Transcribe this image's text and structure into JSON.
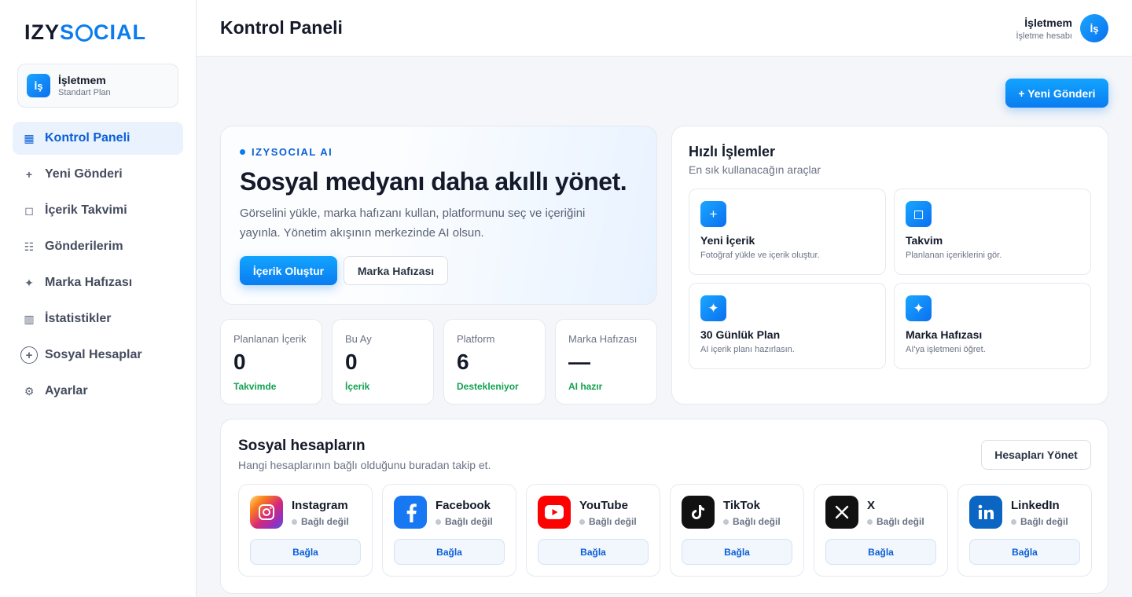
{
  "brand": {
    "logo_part1": "IZY",
    "logo_part2": "S",
    "logo_part3": "CIAL"
  },
  "business": {
    "initials": "İş",
    "name": "İşletmem",
    "plan": "Standart Plan"
  },
  "sidebar": {
    "items": [
      {
        "label": "Kontrol Paneli",
        "icon": "grid-icon",
        "glyph": "▦",
        "active": true
      },
      {
        "label": "Yeni Gönderi",
        "icon": "plus-icon",
        "glyph": "+"
      },
      {
        "label": "İçerik Takvimi",
        "icon": "square-icon",
        "glyph": "◻"
      },
      {
        "label": "Gönderilerim",
        "icon": "list-icon",
        "glyph": "☷"
      },
      {
        "label": "Marka Hafızası",
        "icon": "sparkle-icon",
        "glyph": "✦"
      },
      {
        "label": "İstatistikler",
        "icon": "bars-icon",
        "glyph": "▥"
      },
      {
        "label": "Sosyal Hesaplar",
        "icon": "plus-circle-icon",
        "glyph": "+"
      },
      {
        "label": "Ayarlar",
        "icon": "gear-icon",
        "glyph": "⚙"
      }
    ]
  },
  "header": {
    "title": "Kontrol Paneli",
    "user_name": "İşletmem",
    "user_sub": "İşletme hesabı",
    "user_initials": "İş"
  },
  "actions": {
    "new_post": "+ Yeni Gönderi"
  },
  "hero": {
    "tag": "IZYSOCIAL AI",
    "title": "Sosyal medyanı daha akıllı yönet.",
    "description": "Görselini yükle, marka hafızanı kullan, platformunu seç ve içeriğini yayınla. Yönetim akışının merkezinde AI olsun.",
    "primary_button": "İçerik Oluştur",
    "secondary_button": "Marka Hafızası"
  },
  "stats": [
    {
      "label": "Planlanan İçerik",
      "value": "0",
      "sub": "Takvimde"
    },
    {
      "label": "Bu Ay",
      "value": "0",
      "sub": "İçerik"
    },
    {
      "label": "Platform",
      "value": "6",
      "sub": "Destekleniyor"
    },
    {
      "label": "Marka Hafızası",
      "value": "—",
      "sub": "AI hazır"
    }
  ],
  "quick": {
    "title": "Hızlı İşlemler",
    "subtitle": "En sık kullanacağın araçlar",
    "items": [
      {
        "icon": "plus-icon",
        "glyph": "+",
        "title": "Yeni İçerik",
        "desc": "Fotoğraf yükle ve içerik oluştur."
      },
      {
        "icon": "square-icon",
        "glyph": "◻",
        "title": "Takvim",
        "desc": "Planlanan içeriklerini gör."
      },
      {
        "icon": "sparkle-icon",
        "glyph": "✦",
        "title": "30 Günlük Plan",
        "desc": "AI içerik planı hazırlasın."
      },
      {
        "icon": "sparkle-icon",
        "glyph": "✦",
        "title": "Marka Hafızası",
        "desc": "AI'ya işletmeni öğret."
      }
    ]
  },
  "social": {
    "title": "Sosyal hesapların",
    "subtitle": "Hangi hesaplarının bağlı olduğunu buradan takip et.",
    "manage_button": "Hesapları Yönet",
    "platforms": [
      {
        "name": "Instagram",
        "status": "Bağlı değil",
        "button": "Bağla",
        "icon": "instagram-icon"
      },
      {
        "name": "Facebook",
        "status": "Bağlı değil",
        "button": "Bağla",
        "icon": "facebook-icon"
      },
      {
        "name": "YouTube",
        "status": "Bağlı değil",
        "button": "Bağla",
        "icon": "youtube-icon"
      },
      {
        "name": "TikTok",
        "status": "Bağlı değil",
        "button": "Bağla",
        "icon": "tiktok-icon"
      },
      {
        "name": "X",
        "status": "Bağlı değil",
        "button": "Bağla",
        "icon": "x-icon"
      },
      {
        "name": "LinkedIn",
        "status": "Bağlı değil",
        "button": "Bağla",
        "icon": "linkedin-icon"
      }
    ]
  },
  "colors": {
    "accent": "#0a7cf0",
    "success": "#12a150",
    "instagram": "#d62976",
    "facebook": "#1877f2",
    "youtube": "#ff0000",
    "tiktok": "#111111",
    "x": "#111111",
    "linkedin": "#0a66c2"
  }
}
